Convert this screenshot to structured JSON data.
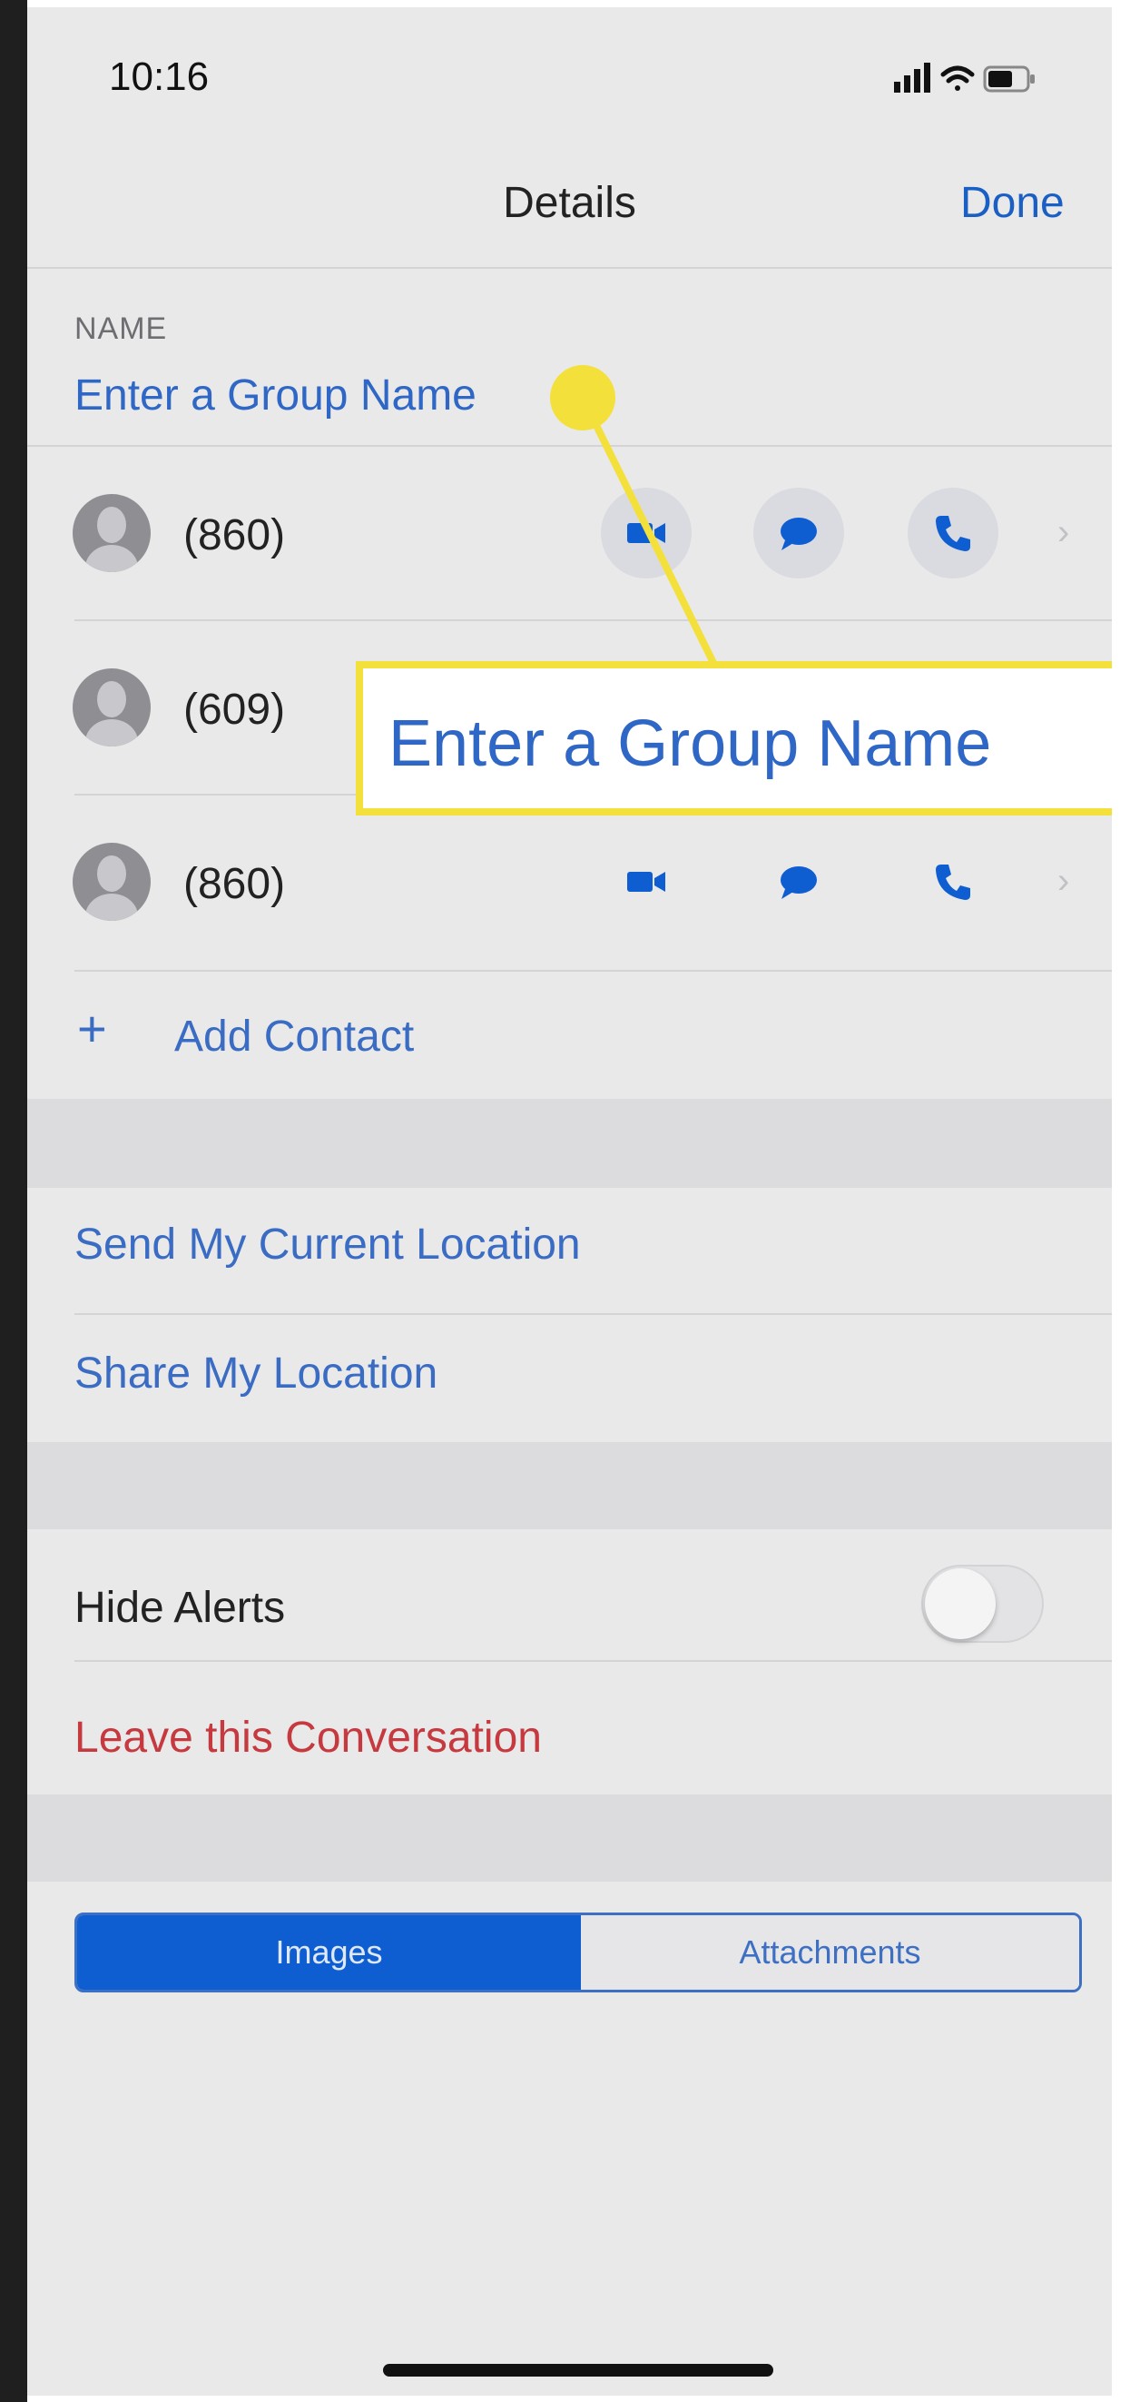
{
  "status_bar": {
    "time": "10:16"
  },
  "nav": {
    "title": "Details",
    "done_label": "Done"
  },
  "name_section": {
    "label": "NAME",
    "placeholder": "Enter a Group Name"
  },
  "contacts": [
    {
      "phone": "(860)"
    },
    {
      "phone": "(609)"
    },
    {
      "phone": "(860)"
    }
  ],
  "add_contact": {
    "label": "Add Contact"
  },
  "location": {
    "send_current": "Send My Current Location",
    "share": "Share My Location"
  },
  "alerts": {
    "hide_label": "Hide Alerts",
    "hide_enabled": false
  },
  "leave": {
    "label": "Leave this Conversation"
  },
  "segmented": {
    "images": "Images",
    "attachments": "Attachments",
    "selected": "Images"
  },
  "annotation": {
    "callout_text": "Enter a Group Name",
    "color": "#f4e03a"
  },
  "colors": {
    "ios_blue": "#0f5ed1",
    "destructive": "#c5393f"
  },
  "icons": [
    "video-icon",
    "message-icon",
    "phone-icon",
    "chevron-right-icon",
    "plus-icon",
    "avatar-icon",
    "signal-icon",
    "wifi-icon",
    "battery-icon"
  ]
}
